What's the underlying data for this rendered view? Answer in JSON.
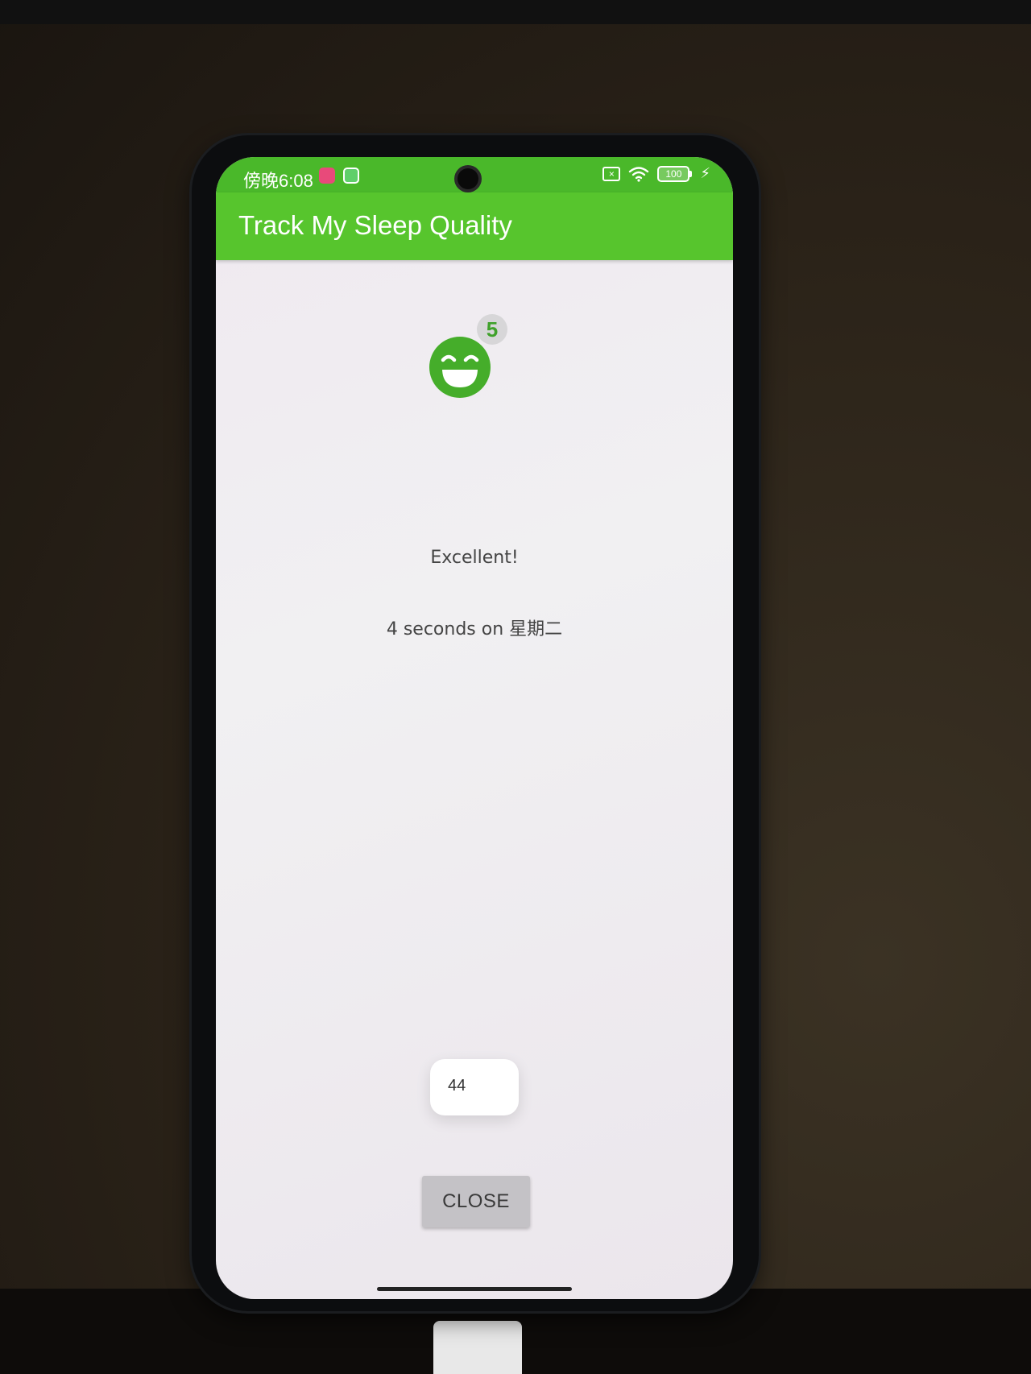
{
  "status_bar": {
    "time": "傍晚6:08",
    "battery_level": "100",
    "sim_icon": "sim-off-icon",
    "wifi_icon": "wifi-icon",
    "charging_icon": "bolt-icon"
  },
  "app_bar": {
    "title": "Track My Sleep Quality",
    "color": "#57c52d"
  },
  "sleep_detail": {
    "quality_icon": "laughing-face-icon",
    "quality_rating": "5",
    "quality_label": "Excellent!",
    "duration_text": "4 seconds on 星期二"
  },
  "toast": {
    "text": "44"
  },
  "actions": {
    "close_label": "CLOSE"
  },
  "colors": {
    "accent": "#57c52d",
    "status_bar": "#4ab82a",
    "face": "#45ad2a",
    "button": "#c4c2c6"
  }
}
